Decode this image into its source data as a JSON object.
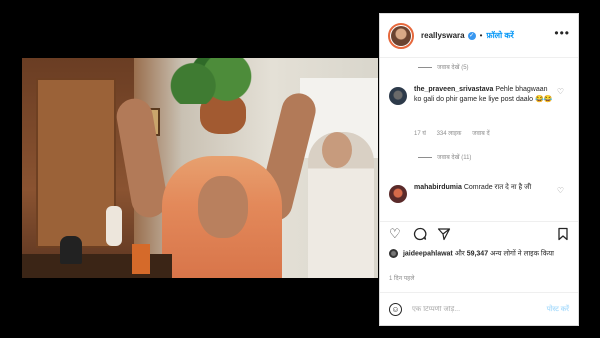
{
  "post": {
    "username": "reallyswara",
    "follow_label": "फ़ॉलो करें",
    "dot": "•",
    "more": "•••",
    "next_arrow": "›",
    "verified_mark": "✓"
  },
  "comments": {
    "top_replies_label": "जवाब देखें (5)",
    "items": [
      {
        "username": "the_praveen_srivastava",
        "text": "Pehle bhagwaan ko gali do phir game ke liye post daalo 😂😂",
        "meta": [
          "17 घं",
          "334 लाइक",
          "जवाब दें"
        ],
        "replies_label": "जवाब देखें (11)"
      },
      {
        "username": "mahabirdumia",
        "text": "Comrade रात दे ना है जी"
      }
    ]
  },
  "likes": {
    "user": "jaideepahlawat",
    "text_prefix": "और",
    "count": "59,347",
    "text_suffix": "अन्य लोगों ने लाइक किया"
  },
  "time_ago": "1 दिन पहले",
  "comment_box": {
    "placeholder": "एक टिप्पणी जोड़ें...",
    "post_label": "पोस्ट करें"
  },
  "icons": {
    "like": "heart-outline-icon",
    "comment": "comment-bubble-icon",
    "share": "paper-plane-icon",
    "save": "bookmark-icon",
    "emoji": "smiley-icon"
  },
  "colors": {
    "link_blue": "#0095f6",
    "verified_blue": "#3897f0",
    "post_disabled": "#b2dffc"
  }
}
